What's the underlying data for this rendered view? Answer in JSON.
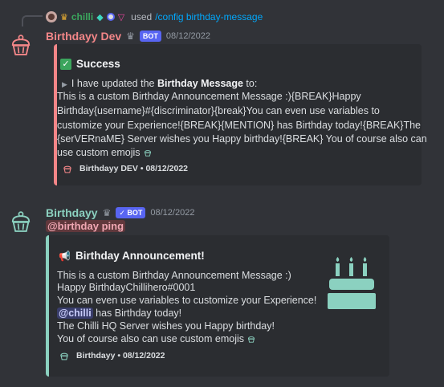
{
  "colors": {
    "background": "#313338",
    "embed_bg": "#2b2d31",
    "dev_accent": "#f38688",
    "birthdayy_accent": "#8bd1c0",
    "bot_tag": "#5865f2",
    "command_link": "#00a8fc"
  },
  "reply": {
    "user": "chilli",
    "used_text": "used",
    "command": "/config birthday-message"
  },
  "message1": {
    "author": "Birthdayy Dev",
    "bot_tag": "BOT",
    "timestamp": "08/12/2022",
    "embed": {
      "title": "Success",
      "title_icon": "check-mark-icon",
      "intro_prefix": "I have updated the ",
      "intro_bold": "Birthday Message",
      "intro_suffix": " to:",
      "lines": [
        "This is a custom Birthday Announcement Message :){BREAK}Happy",
        "Birthday{username}#{discriminator}{break}You can even use variables to",
        "customize your Experience!{BREAK}{MENTION} has Birthday today!{BREAK}The",
        "{serVERnaME} Server wishes you Happy birthday!{BREAK} You of course also can",
        "use custom emojis"
      ],
      "footer": "Birthdayy DEV • 08/12/2022"
    }
  },
  "message2": {
    "author": "Birthdayy",
    "bot_tag": "BOT",
    "timestamp": "08/12/2022",
    "mention": "@birthday ping",
    "embed": {
      "title": "Birthday Announcement!",
      "title_icon": "megaphone-icon",
      "line1": "This is a custom Birthday Announcement Message :)",
      "line2": "Happy BirthdayChillihero#0001",
      "line3": "You can even use variables to customize your Experience!",
      "line4_mention": "@chilli",
      "line4_suffix": " has Birthday today!",
      "line5": "The Chilli HQ Server wishes you Happy birthday!",
      "line6": "You of course also can use custom emojis",
      "footer": "Birthdayy • 08/12/2022"
    }
  }
}
